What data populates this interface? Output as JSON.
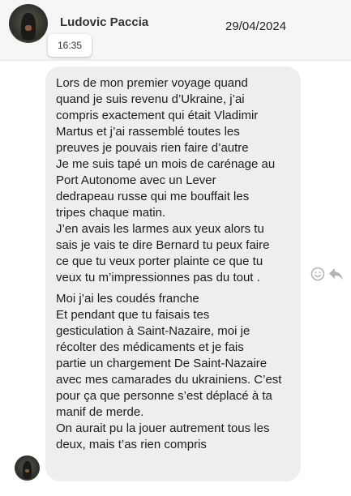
{
  "header": {
    "contact_name": "Ludovic Paccia",
    "date": "29/04/2024",
    "time": "16:35"
  },
  "message": {
    "paragraphs": [
      "Lors de mon premier voyage quand\nquand je suis revenu d’Ukraine, j’ai\ncompris exactement qui était Vladimir\nMartus et j’ai rassemblé toutes les\npreuves je pouvais rien faire d’autre\nJe me suis tapé un mois de carénage au\nPort Autonome avec un    Lever\ndedrapeau russe qui me bouffait les\ntripes chaque matin.\nJ’en avais les larmes aux yeux alors tu\nsais je vais te dire Bernard tu peux faire\nce que tu veux porter plainte ce que tu\nveux tu m’impressionnes pas du tout .",
      "Moi j’ai les coudés franche\nEt pendant que tu faisais tes\ngesticulation à Saint-Nazaire, moi je\nrécolter des médicaments  et je fais\npartie un chargement De Saint-Nazaire\navec mes camarades du ukrainiens. C’est\npour ça que personne s’est déplacé à ta\nmanif de merde.\nOn aurait pu la jouer autrement tous les\ndeux, mais t’as rien compris"
    ]
  },
  "actions": {
    "react_icon": "smiley-icon",
    "reply_icon": "reply-arrow-icon"
  },
  "colors": {
    "header_bg": "#f6f6f6",
    "bubble_bg": "#eeeeee",
    "icon": "#b3b3b3"
  }
}
